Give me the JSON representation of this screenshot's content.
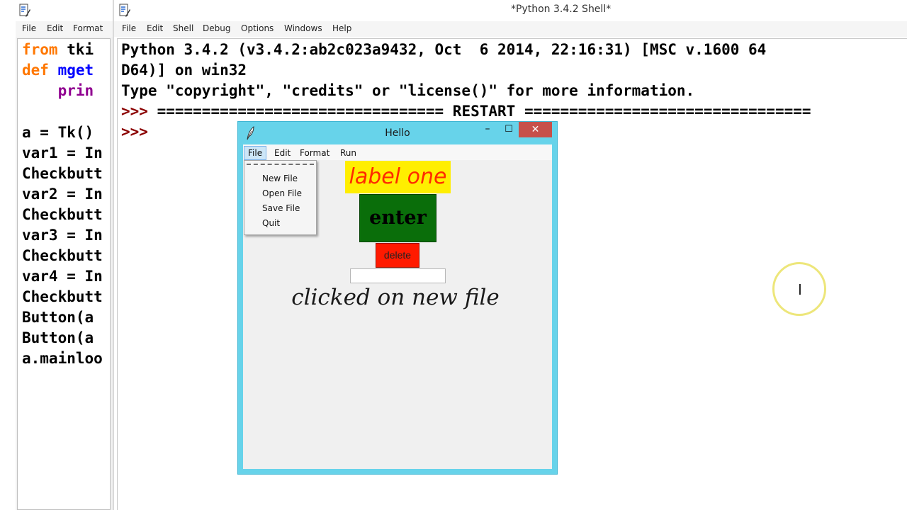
{
  "editor": {
    "menu": [
      "File",
      "Edit",
      "Format"
    ],
    "code_lines": [
      {
        "kw": "from",
        "rest": " tki"
      },
      {
        "kw": "def",
        "fn": " mget"
      },
      {
        "indent": "    ",
        "bi": "prin"
      },
      {
        "rest": ""
      },
      {
        "rest": "a = Tk()"
      },
      {
        "rest": "var1 = In"
      },
      {
        "rest": "Checkbutt"
      },
      {
        "rest": "var2 = In"
      },
      {
        "rest": "Checkbutt"
      },
      {
        "rest": "var3 = In"
      },
      {
        "rest": "Checkbutt"
      },
      {
        "rest": "var4 = In"
      },
      {
        "rest": "Checkbutt"
      },
      {
        "rest": "Button(a"
      },
      {
        "rest": "Button(a"
      },
      {
        "rest": "a.mainloo"
      }
    ]
  },
  "shell": {
    "title": "*Python 3.4.2 Shell*",
    "menu": [
      "File",
      "Edit",
      "Shell",
      "Debug",
      "Options",
      "Windows",
      "Help"
    ],
    "lines": [
      {
        "prompt": "",
        "text": "Python 3.4.2 (v3.4.2:ab2c023a9432, Oct  6 2014, 22:16:31) [MSC v.1600 64"
      },
      {
        "prompt": "",
        "text": "D64)] on win32"
      },
      {
        "prompt": "",
        "text": "Type \"copyright\", \"credits\" or \"license()\" for more information."
      },
      {
        "prompt": ">>>",
        "text": " ================================ RESTART ================================"
      },
      {
        "prompt": ">>>",
        "text": ""
      }
    ]
  },
  "hello_window": {
    "title": "Hello",
    "min_glyph": "–",
    "max_glyph": "☐",
    "close_glyph": "✕",
    "menu": [
      "File",
      "Edit",
      "Format",
      "Run"
    ],
    "active_menu": "File",
    "label_one": "label one",
    "enter_label": "enter",
    "delete_label": "delete",
    "entry_value": "",
    "clicked_text": "clicked on new file",
    "file_menu_items": [
      "New File",
      "Open File",
      "Save File",
      "Quit"
    ]
  },
  "cursor": {
    "glyph": "I"
  },
  "colors": {
    "label_bg": "#ffee00",
    "label_fg": "#ff2a00",
    "enter_bg": "#0a6e0a",
    "delete_bg": "#ff1a00",
    "window_frame": "#67d3ea",
    "close_button": "#c7504a"
  }
}
